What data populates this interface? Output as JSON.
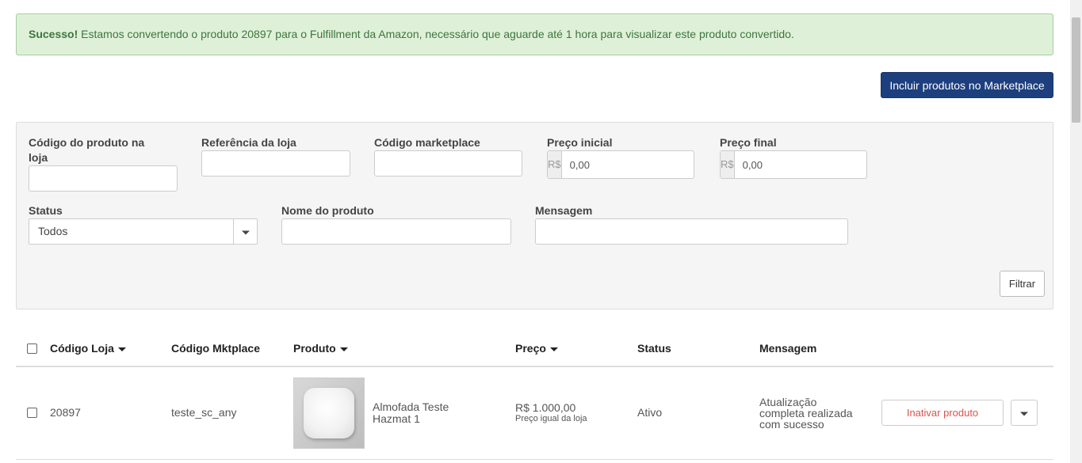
{
  "alert": {
    "strong": "Sucesso!",
    "message": "Estamos convertendo o produto 20897 para o Fulfillment da Amazon, necessário que aguarde até 1 hora para visualizar este produto convertido."
  },
  "actions": {
    "add_products": "Incluir produtos no Marketplace"
  },
  "filters": {
    "codigo_loja": {
      "label_line1": "Código do produto na",
      "label_line2": "loja",
      "value": ""
    },
    "referencia": {
      "label": "Referência da loja",
      "value": ""
    },
    "codigo_marketplace": {
      "label": "Código marketplace",
      "value": ""
    },
    "preco_inicial": {
      "label": "Preço inicial",
      "currency": "R$",
      "value": "0,00"
    },
    "preco_final": {
      "label": "Preço final",
      "currency": "R$",
      "value": "0,00"
    },
    "status": {
      "label": "Status",
      "selected": "Todos"
    },
    "nome_produto": {
      "label": "Nome do produto",
      "value": ""
    },
    "mensagem": {
      "label": "Mensagem",
      "value": ""
    },
    "submit": "Filtrar"
  },
  "table": {
    "headers": {
      "codigo_loja": "Código Loja",
      "codigo_mktplace": "Código Mktplace",
      "produto": "Produto",
      "preco": "Preço",
      "status": "Status",
      "mensagem": "Mensagem"
    },
    "rows": [
      {
        "codigo_loja": "20897",
        "codigo_mktplace": "teste_sc_any",
        "produto_line1": "Almofada Teste",
        "produto_line2": "Hazmat 1",
        "preco": "R$ 1.000,00",
        "preco_nota": "Preço igual da loja",
        "status": "Ativo",
        "mensagem_line1": "Atualização",
        "mensagem_line2": "completa realizada",
        "mensagem_line3": "com sucesso",
        "action": "Inativar produto"
      }
    ]
  },
  "colors": {
    "success_bg": "#dff0d8",
    "success_text": "#3c763d",
    "primary": "#1d3f7e",
    "danger": "#d9534f"
  },
  "icons": [
    "caret-down-icon",
    "pillow-product-image"
  ]
}
